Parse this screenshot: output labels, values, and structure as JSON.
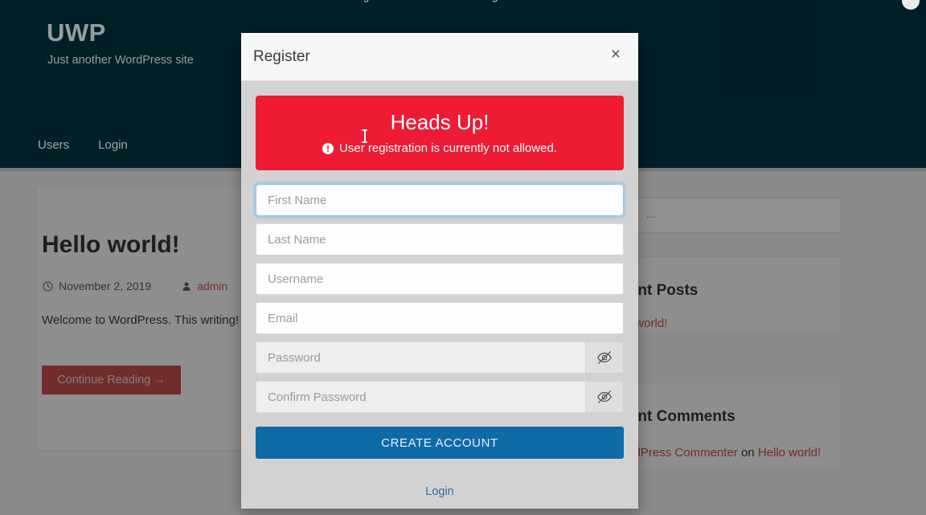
{
  "site": {
    "title": "UWP",
    "tagline": "Just another WordPress site",
    "nav": [
      {
        "label": "Users"
      },
      {
        "label": "Login"
      }
    ],
    "clipped_topbar": [
      {
        "label": "g"
      },
      {
        "label": "g"
      }
    ]
  },
  "post": {
    "title": "Hello world!",
    "date": "November 2, 2019",
    "author": "admin",
    "excerpt": "Welcome to WordPress. This writing!",
    "continue_label": "Continue Reading →"
  },
  "sidebar": {
    "search_placeholder": "...",
    "search_value": "",
    "recent_posts": {
      "title": "Recent Posts",
      "items": [
        {
          "label": "Hello world!"
        }
      ]
    },
    "recent_comments": {
      "title": "Recent Comments",
      "items": [
        {
          "author": "A WordPress Commenter",
          "connector": " on ",
          "post": "Hello world!"
        }
      ]
    }
  },
  "modal": {
    "title": "Register",
    "close_label": "×",
    "alert": {
      "heading": "Heads Up!",
      "message": "User registration is currently not allowed.",
      "icon": "exclamation-circle-icon",
      "color": "#ED1B34"
    },
    "fields": [
      {
        "name": "first-name",
        "placeholder": "First Name",
        "value": "",
        "focused": true,
        "type": "text"
      },
      {
        "name": "last-name",
        "placeholder": "Last Name",
        "value": "",
        "focused": false,
        "type": "text"
      },
      {
        "name": "username",
        "placeholder": "Username",
        "value": "",
        "focused": false,
        "type": "text"
      },
      {
        "name": "email",
        "placeholder": "Email",
        "value": "",
        "focused": false,
        "type": "text"
      }
    ],
    "password_fields": [
      {
        "name": "password",
        "placeholder": "Password",
        "value": "",
        "toggle_icon": "eye-slash-icon"
      },
      {
        "name": "confirm-password",
        "placeholder": "Confirm Password",
        "value": "",
        "toggle_icon": "eye-slash-icon"
      }
    ],
    "submit_label": "CREATE ACCOUNT",
    "submit_color": "#0F6AA8",
    "footer_link": "Login"
  }
}
